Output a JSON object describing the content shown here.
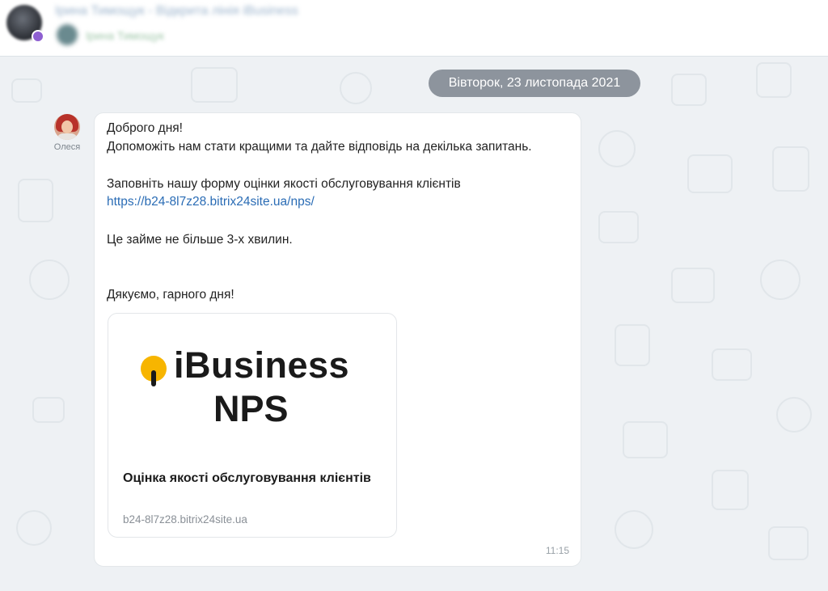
{
  "header": {
    "chat_title": "Ірина Тимощук - Відкрита лінія iBusiness",
    "subtitle": "Ірина Тимощук",
    "platform_icon": "viber-icon",
    "accent": "#8e5fd1"
  },
  "chat": {
    "date_separator": "Вівторок, 23 листопада 2021",
    "message": {
      "sender_name": "Олеся",
      "lines": {
        "greeting": "Доброго дня!",
        "request": "Допоможіть нам стати кращими та дайте відповідь на декілька запитань.",
        "form_prompt": "Заповніть нашу форму оцінки якості обслуговування клієнтів",
        "link": "https://b24-8l7z28.bitrix24site.ua/nps/",
        "duration": "Це займе не більше 3-х хвилин.",
        "thanks": "Дякуємо, гарного дня!"
      },
      "link_preview": {
        "logo_line1": "iBusiness",
        "logo_line2": "NPS",
        "title": "Оцінка якості обслуговування клієнтів",
        "domain": "b24-8l7z28.bitrix24site.ua"
      },
      "time": "11:15"
    }
  },
  "colors": {
    "link": "#2a6cb5",
    "date_pill": "#8d949d",
    "logo_accent": "#f7b500",
    "background": "#eef1f4"
  }
}
